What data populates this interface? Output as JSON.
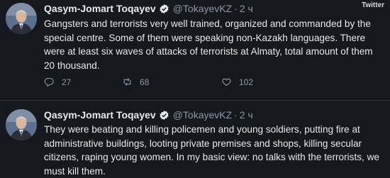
{
  "watermark": "Twitter",
  "tweets": [
    {
      "author_name": "Qasym-Jomart Toqayev",
      "handle": "@TokayevKZ",
      "separator": "·",
      "time": "2 ч",
      "text": "Gangsters and terrorists very well trained, organized and commanded by the special centre. Some of them were speaking non-Kazakh languages. There were at least six waves of attacks of terrorists at Almaty, total amount of them 20 thousand.",
      "replies": "27",
      "retweets": "68",
      "likes": "102"
    },
    {
      "author_name": "Qasym-Jomart Toqayev",
      "handle": "@TokayevKZ",
      "separator": "·",
      "time": "2 ч",
      "text": "They were beating and killing policemen and young soldiers, putting fire at administrative buildings, looting private premises and shops, killing secular citizens, raping young women. In my basic view: no talks with the terrorists, we must kill them."
    }
  ],
  "icons": {
    "verified": "verified-badge-icon",
    "reply": "reply-icon",
    "retweet": "retweet-icon",
    "like": "heart-icon"
  },
  "colors": {
    "background": "#15181c",
    "text": "#e7e9ea",
    "muted": "#8b98a5",
    "verified_badge": "#1d9bf0"
  }
}
